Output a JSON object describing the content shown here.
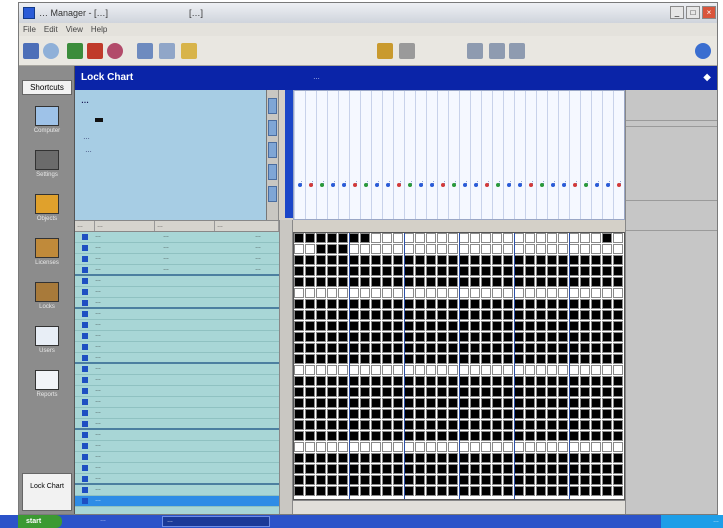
{
  "window": {
    "title": "… Manager - […]",
    "title_field": "[…]",
    "controls": [
      "_",
      "□",
      "×"
    ]
  },
  "menu": [
    "File",
    "Edit",
    "View",
    "Help"
  ],
  "toolbar": {
    "icons": [
      "save-icon",
      "search-icon",
      "play-icon",
      "stop-icon",
      "record-icon",
      "settings-icon",
      "sign-icon",
      "help-icon",
      "grid-icon",
      "chart-icon",
      "print-icon",
      "connect-icon"
    ]
  },
  "sidebar": {
    "header": "Shortcuts",
    "items": [
      {
        "label": "Computer",
        "icon": "computer-icon"
      },
      {
        "label": "Settings",
        "icon": "gear-icon"
      },
      {
        "label": "Objects",
        "icon": "box-icon"
      },
      {
        "label": "Licenses",
        "icon": "license-icon"
      },
      {
        "label": "Locks",
        "icon": "lock-icon"
      },
      {
        "label": "Users",
        "icon": "user-icon"
      },
      {
        "label": "Reports",
        "icon": "report-icon"
      }
    ],
    "footer": "Lock Chart"
  },
  "lock_chart": {
    "header_title": "Lock Chart",
    "header_subtitle": "…",
    "nav_icon": "nav-arrows-icon",
    "info_title": "…",
    "info_line_1": "…",
    "info_line_2": "…"
  },
  "table": {
    "headers": [
      "…",
      "…",
      "…",
      "…"
    ],
    "rows": [
      {
        "name": "…",
        "value": "…",
        "count": "…"
      },
      {
        "name": "…",
        "value": "…",
        "count": "…"
      },
      {
        "name": "…",
        "value": "…",
        "count": "…"
      },
      {
        "name": "…",
        "value": "…",
        "count": "…"
      },
      {
        "name": "…",
        "value": "",
        "count": ""
      },
      {
        "name": "…",
        "value": "",
        "count": ""
      },
      {
        "name": "…",
        "value": "",
        "count": ""
      },
      {
        "name": "…",
        "value": "",
        "count": ""
      },
      {
        "name": "…",
        "value": "",
        "count": ""
      },
      {
        "name": "…",
        "value": "",
        "count": ""
      },
      {
        "name": "…",
        "value": "",
        "count": ""
      },
      {
        "name": "…",
        "value": "",
        "count": ""
      },
      {
        "name": "…",
        "value": "",
        "count": ""
      },
      {
        "name": "…",
        "value": "",
        "count": ""
      },
      {
        "name": "…",
        "value": "",
        "count": ""
      },
      {
        "name": "…",
        "value": "",
        "count": ""
      },
      {
        "name": "…",
        "value": "",
        "count": ""
      },
      {
        "name": "…",
        "value": "",
        "count": ""
      },
      {
        "name": "…",
        "value": "",
        "count": ""
      },
      {
        "name": "…",
        "value": "",
        "count": ""
      },
      {
        "name": "…",
        "value": "",
        "count": ""
      },
      {
        "name": "…",
        "value": "",
        "count": ""
      },
      {
        "name": "…",
        "value": "",
        "count": ""
      },
      {
        "name": "…",
        "value": "",
        "count": ""
      },
      {
        "name": "…",
        "value": "",
        "count": ""
      }
    ]
  },
  "module_header": {
    "columns": [
      "…",
      "…",
      "…",
      "…",
      "…",
      "…",
      "…",
      "…",
      "…",
      "…",
      "…",
      "…",
      "…",
      "…",
      "…",
      "…",
      "…",
      "…",
      "…",
      "…",
      "…",
      "…",
      "…",
      "…",
      "…",
      "…",
      "…",
      "…",
      "…",
      "…"
    ]
  },
  "taskbar": {
    "start_label": "start",
    "quick_launch": "…",
    "task_item": "…",
    "tray_time": "…"
  },
  "colors": {
    "header_blue": "#0a24a8",
    "info_blue": "#a7cde4",
    "list_teal": "#a8d6d6",
    "selection_blue": "#2e8ce6",
    "matrix_filled": "#000000",
    "matrix_empty": "#ffffff"
  }
}
